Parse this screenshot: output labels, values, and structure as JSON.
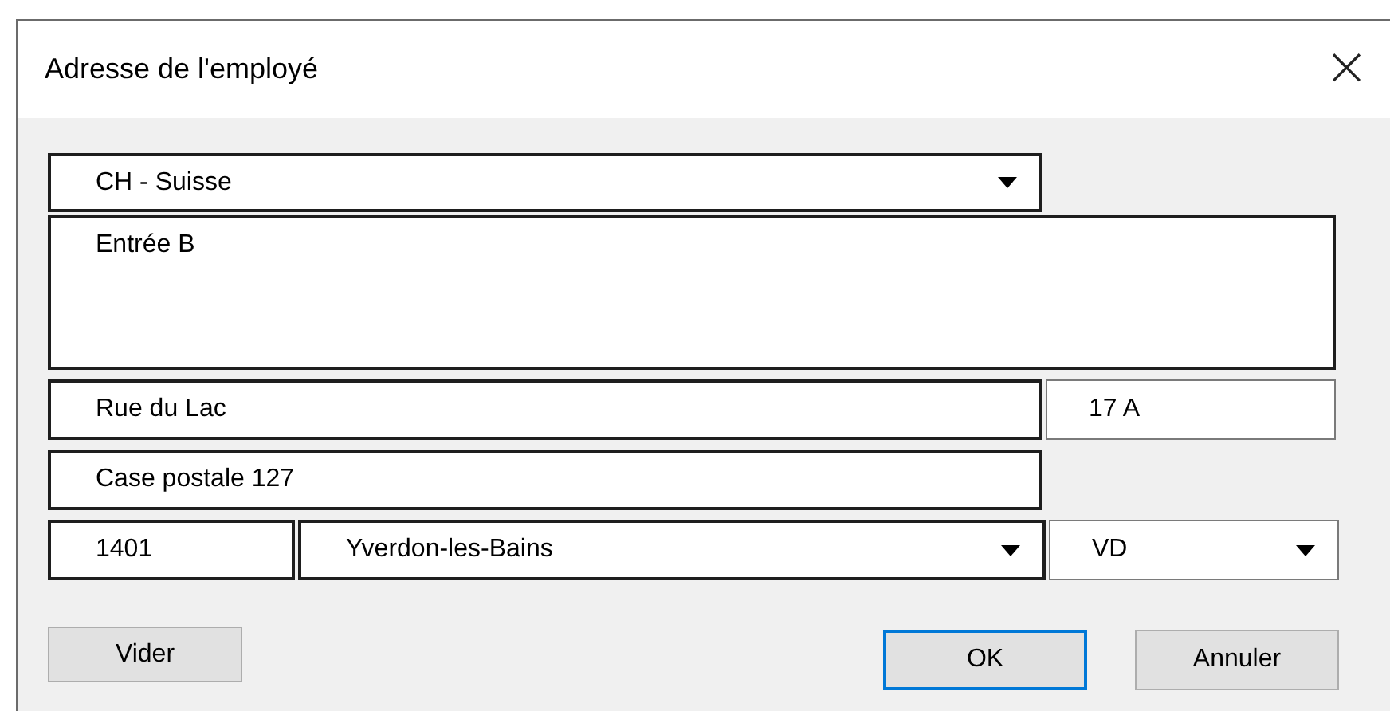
{
  "window": {
    "title": "Adresse de l'employé",
    "close": "×"
  },
  "rows": [
    [
      {
        "kind": "dropdown",
        "value": "CH - Suisse"
      }
    ],
    [
      {
        "kind": "multiline",
        "value": "Entrée B"
      }
    ],
    [
      {
        "kind": "text",
        "value": "Rue du Lac"
      },
      {
        "kind": "text",
        "value": "17 A"
      }
    ],
    [
      {
        "kind": "text",
        "value": "Case postale 127"
      }
    ],
    [
      {
        "kind": "text",
        "value": "1401"
      },
      {
        "kind": "dropdown",
        "value": "Yverdon-les-Bains"
      },
      {
        "kind": "dropdown",
        "value": "VD"
      }
    ]
  ],
  "clear_button": {
    "label": "Vider"
  },
  "buttons": [
    {
      "label": "OK",
      "default": true
    },
    {
      "label": "Annuler",
      "default": false
    }
  ]
}
